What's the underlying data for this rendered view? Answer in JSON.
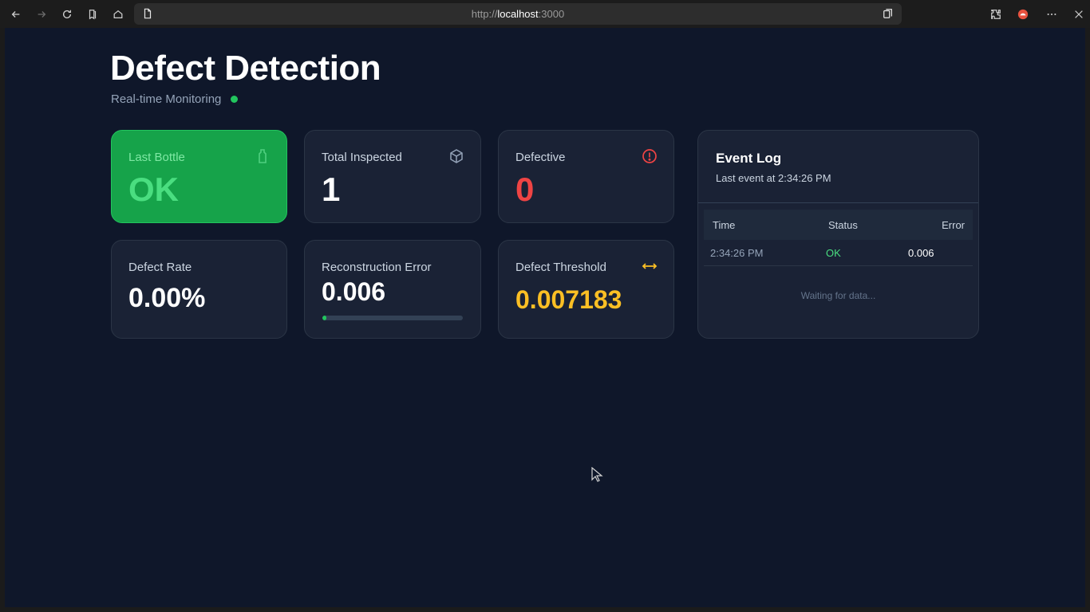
{
  "browser": {
    "url_scheme": "http://",
    "url_host": "localhost",
    "url_port": ":3000",
    "icons": [
      "back-icon",
      "forward-icon",
      "reload-icon",
      "bookmarks-icon",
      "home-icon",
      "page-icon",
      "collections-icon",
      "extensions-icon",
      "profile-icon",
      "more-icon",
      "close-icon"
    ]
  },
  "header": {
    "title": "Defect Detection",
    "subtitle": "Real-time Monitoring",
    "live_color": "#22c55e"
  },
  "cards": {
    "last_bottle": {
      "label": "Last Bottle",
      "value": "OK",
      "icon": "bottle-icon"
    },
    "total_inspected": {
      "label": "Total Inspected",
      "value": "1",
      "icon": "box-icon"
    },
    "defective": {
      "label": "Defective",
      "value": "0",
      "icon": "alert-circle-icon",
      "color": "#ef4444"
    },
    "defect_rate": {
      "label": "Defect Rate",
      "value": "0.00%"
    },
    "reconstruction_error": {
      "label": "Reconstruction Error",
      "value": "0.006",
      "progress_fraction": 0.03
    },
    "defect_threshold": {
      "label": "Defect Threshold",
      "value": "0.007183",
      "icon": "arrows-horizontal-icon",
      "color": "#fbbf24"
    }
  },
  "event_log": {
    "title": "Event Log",
    "subtitle": "Last event at 2:34:26 PM",
    "columns": [
      "Time",
      "Status",
      "Error"
    ],
    "rows": [
      {
        "time": "2:34:26 PM",
        "status": "OK",
        "error": "0.006"
      }
    ],
    "waiting_text": "Waiting for data..."
  },
  "colors": {
    "page_bg": "#0f172a",
    "card_bg": "#1a2235",
    "ok_green": "#16a34a"
  }
}
